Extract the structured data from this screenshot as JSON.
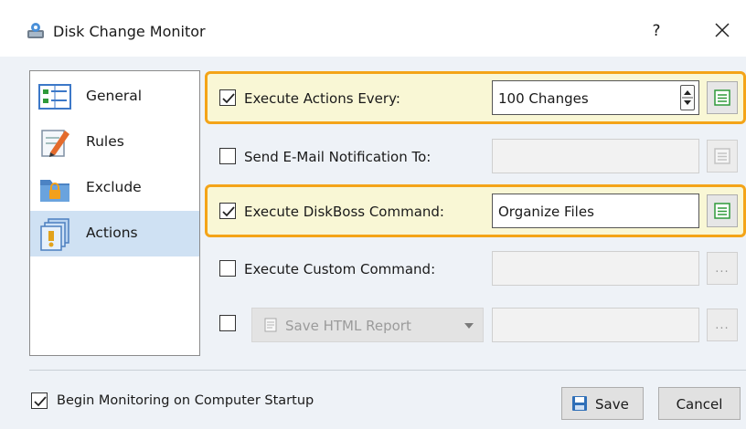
{
  "window": {
    "title": "Disk Change Monitor",
    "help_label": "?"
  },
  "sidebar": {
    "items": [
      {
        "label": "General"
      },
      {
        "label": "Rules"
      },
      {
        "label": "Exclude"
      },
      {
        "label": "Actions",
        "selected": true
      }
    ]
  },
  "actions": {
    "execute_every": {
      "label": "Execute Actions Every:",
      "checked": true,
      "value": "100 Changes"
    },
    "send_email": {
      "label": "Send E-Mail Notification To:",
      "checked": false,
      "value": ""
    },
    "diskboss_command": {
      "label": "Execute DiskBoss Command:",
      "checked": true,
      "value": "Organize Files"
    },
    "custom_command": {
      "label": "Execute Custom Command:",
      "checked": false,
      "value": "",
      "browse_label": "..."
    },
    "report": {
      "checked": false,
      "selected_option": "Save HTML Report",
      "value": "",
      "browse_label": "..."
    }
  },
  "footer": {
    "startup_label": "Begin Monitoring on Computer Startup",
    "startup_checked": true,
    "save_label": "Save",
    "cancel_label": "Cancel"
  },
  "colors": {
    "highlight_border": "#f4a418",
    "highlight_fill": "#f9f7d5",
    "selection": "#cfe1f3",
    "client_bg": "#eef2f7"
  },
  "icons": [
    "drive-monitor-icon",
    "general-list-icon",
    "rules-pencil-icon",
    "exclude-folder-lock-icon",
    "actions-stack-icon",
    "list-picker-icon",
    "floppy-save-icon",
    "close-icon"
  ]
}
